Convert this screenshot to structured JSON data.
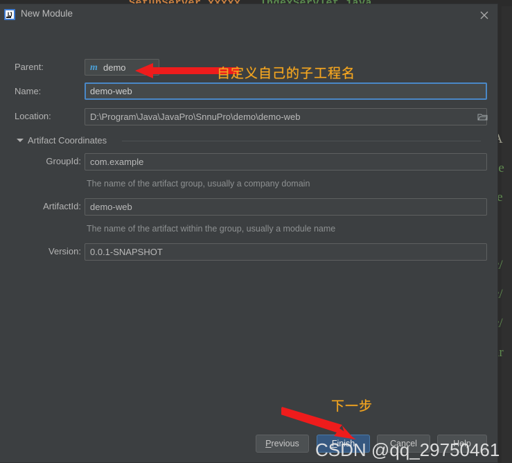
{
  "background": {
    "top_strip_segments": [
      {
        "text": "SetupServer.xxxxx",
        "color": "#cc8242"
      },
      {
        "text": "IndexServlet.java",
        "color": "#5a8a4e"
      }
    ],
    "code_fragments": [
      "A",
      "se",
      "te",
      "c/",
      "c/",
      "c/",
      "ar"
    ]
  },
  "dialog": {
    "title": "New Module",
    "app_icon": "IJ",
    "close_label": "Close",
    "fields": {
      "parent": {
        "label": "Parent:",
        "value": "demo",
        "icon": "m",
        "icon_name": "maven-module-icon"
      },
      "name": {
        "label": "Name:",
        "value": "demo-web",
        "focused": true
      },
      "location": {
        "label": "Location:",
        "value": "D:\\Program\\Java\\JavaPro\\SnnuPro\\demo\\demo-web",
        "browse_icon": "folder-icon"
      }
    },
    "artifact_section": {
      "title": "Artifact Coordinates",
      "expanded": true,
      "group_id": {
        "label": "GroupId:",
        "value": "com.example",
        "hint": "The name of the artifact group, usually a company domain"
      },
      "artifact_id": {
        "label": "ArtifactId:",
        "value": "demo-web",
        "hint": "The name of the artifact within the group, usually a module name"
      },
      "version": {
        "label": "Version:",
        "value": "0.0.1-SNAPSHOT"
      }
    },
    "buttons": {
      "previous": "Previous",
      "finish": "Finish",
      "cancel": "Cancel",
      "help": "Help"
    }
  },
  "annotations": {
    "name_note": "自定义自己的子工程名",
    "finish_note": "下一步",
    "arrow_color": "#ee1c1c",
    "text_color": "#f5a623"
  },
  "watermark": {
    "text": "CSDN @qq_29750461"
  }
}
